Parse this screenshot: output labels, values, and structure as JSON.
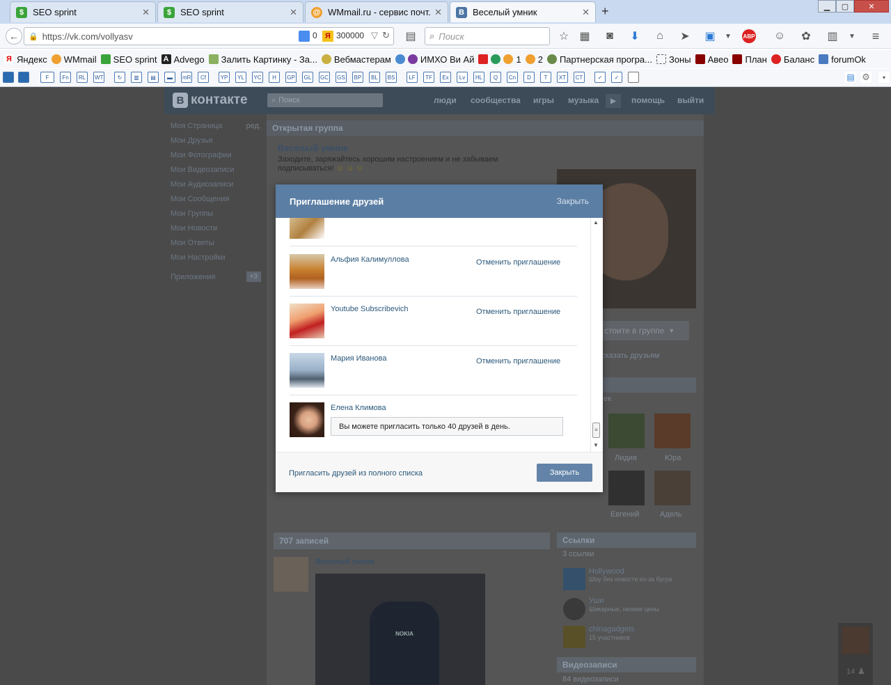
{
  "browser": {
    "tabs": [
      {
        "title": "SEO sprint",
        "active": false
      },
      {
        "title": "SEO sprint",
        "active": false
      },
      {
        "title": "WMmail.ru - сервис почт...",
        "active": false
      },
      {
        "title": "Веселый умник",
        "active": true
      }
    ],
    "url": "https://vk.com/vollyasv",
    "google_count": "0",
    "yandex_count": "300000",
    "search_placeholder": "Поиск",
    "bookmarks": [
      "Яндекс",
      "WMmail",
      "SEO sprint",
      "Advego",
      "Залить Картинку - За...",
      "Вебмастерам",
      "ИМХО Ви Ай",
      "1",
      "2",
      "Партнерская програ...",
      "Зоны",
      "Авео",
      "План",
      "Баланс",
      "forumOk"
    ],
    "toolbar_buttons": [
      "F",
      "Fn",
      "RL",
      "WT",
      "",
      "",
      "",
      "",
      "mR",
      "Cf",
      "YP",
      "YL",
      "YC",
      "H",
      "GP",
      "GL",
      "GC",
      "GS",
      "BP",
      "BL",
      "BS",
      "LF",
      "TF",
      "Ex",
      "Lv",
      "HL",
      "Q",
      "Cn",
      "D",
      "T",
      "XT",
      "CT"
    ]
  },
  "vk": {
    "logo": "контакте",
    "search_placeholder": "Поиск",
    "nav": [
      "люди",
      "сообщества",
      "игры",
      "музыка",
      "помощь",
      "выйти"
    ],
    "left_menu": [
      "Моя Страница",
      "Мои Друзья",
      "Мои Фотографии",
      "Мои Видеозаписи",
      "Мои Аудиозаписи",
      "Мои Сообщения",
      "Мои Группы",
      "Мои Новости",
      "Мои Ответы",
      "Мои Настройки"
    ],
    "edit_label": "ред.",
    "apps_label": "Приложения",
    "apps_badge": "+3",
    "group_type": "Открытая группа",
    "group_name": "Веселый умник",
    "group_status": "Заходите, заряжайтесь хорошим настроением и не забываем подписываться!",
    "member_status": "стоите в группе",
    "tell_friends": "сказать друзьям",
    "members_count_frag": "ек",
    "members": [
      "Лидия",
      "Юра",
      "Евгений",
      "Адель"
    ],
    "posts_count": "707 записей",
    "post_author": "Веселый умник",
    "links_title": "Ссылки",
    "links_count": "3 ссылки",
    "links": [
      {
        "name": "Hollywood",
        "desc": "Шоу биз новости из-за бугра"
      },
      {
        "name": "Уши",
        "desc": "Шикарные, низкие цены"
      },
      {
        "name": "chinagadgets",
        "desc": "15 участников"
      }
    ],
    "videos_title": "Видеозаписи",
    "videos_count": "84 видеозаписи",
    "chat_count": "14"
  },
  "modal": {
    "title": "Приглашение друзей",
    "close_link": "Закрыть",
    "friends": [
      {
        "name": "Альфия Калимуллова",
        "action": "Отменить приглашение"
      },
      {
        "name": "Youtube Subscribevich",
        "action": "Отменить приглашение"
      },
      {
        "name": "Мария Иванова",
        "action": "Отменить приглашение"
      },
      {
        "name": "Елена Климова",
        "notice": "Вы можете пригласить только 40 друзей в день."
      }
    ],
    "footer_link": "Пригласить друзей из полного списка",
    "close_button": "Закрыть"
  }
}
